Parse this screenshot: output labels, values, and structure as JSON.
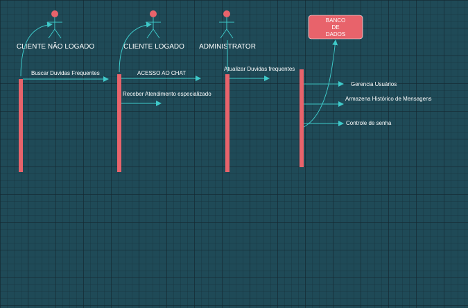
{
  "colors": {
    "background": "#1f4a57",
    "lifeline_fill": "#e8636b",
    "line": "#3ec9c9",
    "text": "#ffffff",
    "actor_head": "#e8636b"
  },
  "actors": [
    {
      "name": "CLIENTE NÃO LOGADO"
    },
    {
      "name": "CLIENTE LOGADO"
    },
    {
      "name": "ADMINISTRATOR"
    }
  ],
  "database": {
    "lines": [
      "BANCO",
      "DE",
      "DADOS"
    ]
  },
  "messages": [
    {
      "label": "Buscar Duvidas Frequentes"
    },
    {
      "label": "ACESSO AO CHAT"
    },
    {
      "label": "Receber Atendimento especializado"
    },
    {
      "label": "Atualizar Duvidas frequentes"
    },
    {
      "label": "Gerencia Usuários"
    },
    {
      "label": "Armazena Histórico de Mensagens"
    },
    {
      "label": "Controle de senha"
    }
  ]
}
